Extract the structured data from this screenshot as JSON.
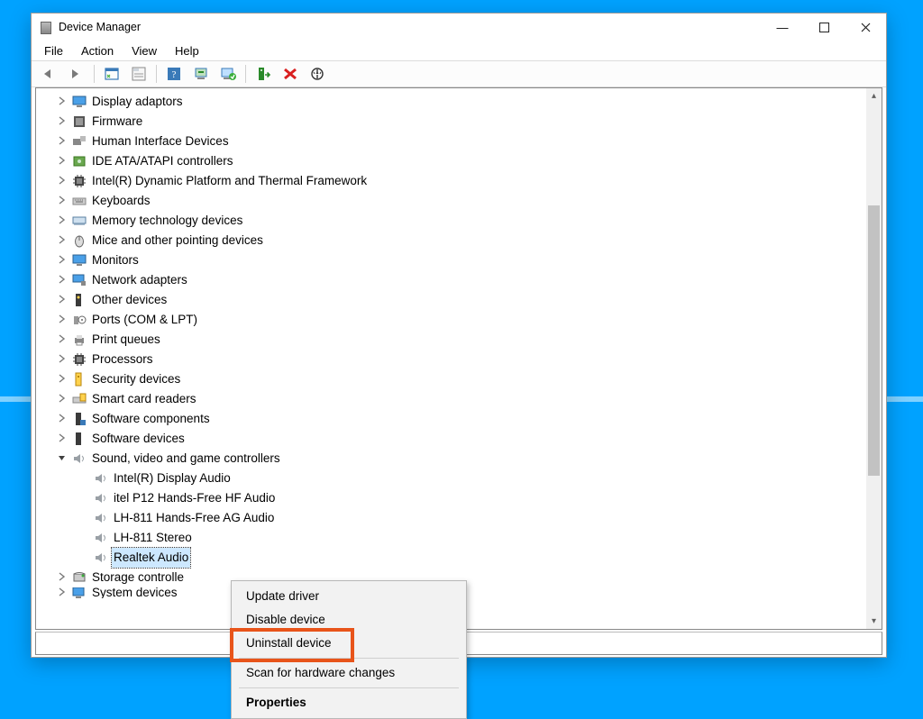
{
  "window": {
    "title": "Device Manager",
    "menubar": [
      "File",
      "Action",
      "View",
      "Help"
    ]
  },
  "toolbar_icons": [
    "back-icon",
    "forward-icon",
    "sep",
    "show-hidden-icon",
    "properties-sheet-icon",
    "sep",
    "help-icon",
    "enable-device-icon",
    "update-driver-icon",
    "sep",
    "uninstall-device-icon",
    "delete-icon",
    "scan-hardware-icon"
  ],
  "tree": [
    {
      "label": "Display adaptors",
      "expanded": false,
      "icon": "display-icon"
    },
    {
      "label": "Firmware",
      "expanded": false,
      "icon": "firmware-icon"
    },
    {
      "label": "Human Interface Devices",
      "expanded": false,
      "icon": "hid-icon"
    },
    {
      "label": "IDE ATA/ATAPI controllers",
      "expanded": false,
      "icon": "ide-icon"
    },
    {
      "label": "Intel(R) Dynamic Platform and Thermal Framework",
      "expanded": false,
      "icon": "chip-icon"
    },
    {
      "label": "Keyboards",
      "expanded": false,
      "icon": "keyboard-icon"
    },
    {
      "label": "Memory technology devices",
      "expanded": false,
      "icon": "memory-icon"
    },
    {
      "label": "Mice and other pointing devices",
      "expanded": false,
      "icon": "mouse-icon"
    },
    {
      "label": "Monitors",
      "expanded": false,
      "icon": "monitor-icon"
    },
    {
      "label": "Network adapters",
      "expanded": false,
      "icon": "network-icon"
    },
    {
      "label": "Other devices",
      "expanded": false,
      "icon": "other-icon"
    },
    {
      "label": "Ports (COM & LPT)",
      "expanded": false,
      "icon": "port-icon"
    },
    {
      "label": "Print queues",
      "expanded": false,
      "icon": "printer-icon"
    },
    {
      "label": "Processors",
      "expanded": false,
      "icon": "cpu-icon"
    },
    {
      "label": "Security devices",
      "expanded": false,
      "icon": "security-icon"
    },
    {
      "label": "Smart card readers",
      "expanded": false,
      "icon": "smartcard-icon"
    },
    {
      "label": "Software components",
      "expanded": false,
      "icon": "software-comp-icon"
    },
    {
      "label": "Software devices",
      "expanded": false,
      "icon": "software-dev-icon"
    },
    {
      "label": "Sound, video and game controllers",
      "expanded": true,
      "icon": "sound-icon",
      "children": [
        {
          "label": "Intel(R) Display Audio",
          "icon": "speaker-icon"
        },
        {
          "label": "itel P12 Hands-Free HF Audio",
          "icon": "speaker-icon"
        },
        {
          "label": "LH-811 Hands-Free AG Audio",
          "icon": "speaker-icon"
        },
        {
          "label": "LH-811 Stereo",
          "icon": "speaker-icon"
        },
        {
          "label": "Realtek Audio",
          "icon": "speaker-icon",
          "selected": true
        }
      ]
    },
    {
      "label": "Storage controllers",
      "expanded": false,
      "icon": "storage-icon",
      "truncated": true
    },
    {
      "label": "System devices",
      "expanded": false,
      "icon": "system-icon",
      "truncated": true,
      "cutoff": true
    }
  ],
  "context_menu": {
    "items": [
      {
        "label": "Update driver",
        "type": "item"
      },
      {
        "label": "Disable device",
        "type": "item"
      },
      {
        "label": "Uninstall device",
        "type": "item",
        "highlighted": true
      },
      {
        "type": "sep"
      },
      {
        "label": "Scan for hardware changes",
        "type": "item"
      },
      {
        "type": "sep"
      },
      {
        "label": "Properties",
        "type": "item",
        "bold": true
      }
    ]
  },
  "win_buttons": {
    "min": "—",
    "max": "□",
    "close": "✕"
  }
}
